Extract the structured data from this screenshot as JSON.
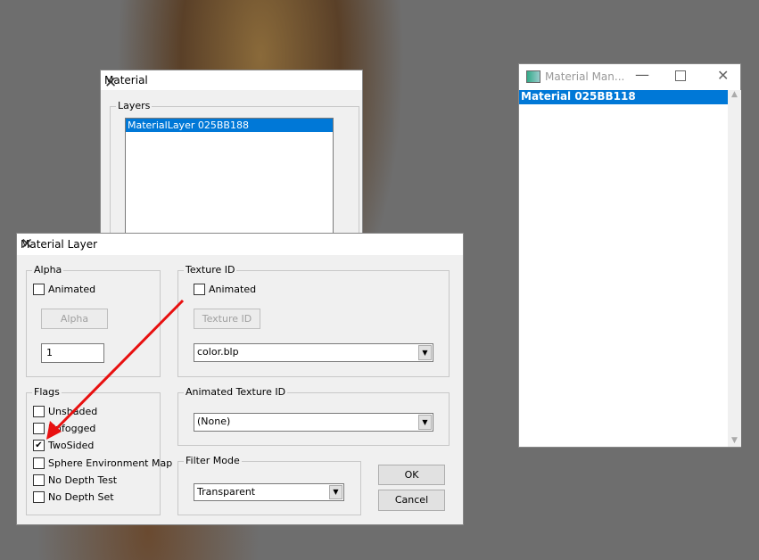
{
  "material_window": {
    "title": "Material",
    "layers_label": "Layers",
    "layers": [
      "MaterialLayer 025BB188"
    ]
  },
  "manager_window": {
    "title": "Material Man...",
    "items": [
      "Material 025BB118"
    ]
  },
  "layer_dialog": {
    "title": "Material Layer",
    "alpha": {
      "label": "Alpha",
      "animated_label": "Animated",
      "animated": false,
      "button": "Alpha",
      "value": "1"
    },
    "texture": {
      "label": "Texture ID",
      "animated_label": "Animated",
      "animated": false,
      "button": "Texture ID",
      "selected": "color.blp"
    },
    "animated_texture": {
      "label": "Animated Texture ID",
      "selected": "(None)"
    },
    "flags": {
      "label": "Flags",
      "items": [
        {
          "label": "Unshaded",
          "checked": false
        },
        {
          "label": "Unfogged",
          "checked": false
        },
        {
          "label": "TwoSided",
          "checked": true
        },
        {
          "label": "Sphere Environment Map",
          "checked": false
        },
        {
          "label": "No Depth Test",
          "checked": false
        },
        {
          "label": "No Depth Set",
          "checked": false
        }
      ]
    },
    "filter_mode": {
      "label": "Filter Mode",
      "selected": "Transparent"
    },
    "ok": "OK",
    "cancel": "Cancel"
  },
  "colors": {
    "selection": "#0078d7",
    "arrow": "#e81010"
  }
}
